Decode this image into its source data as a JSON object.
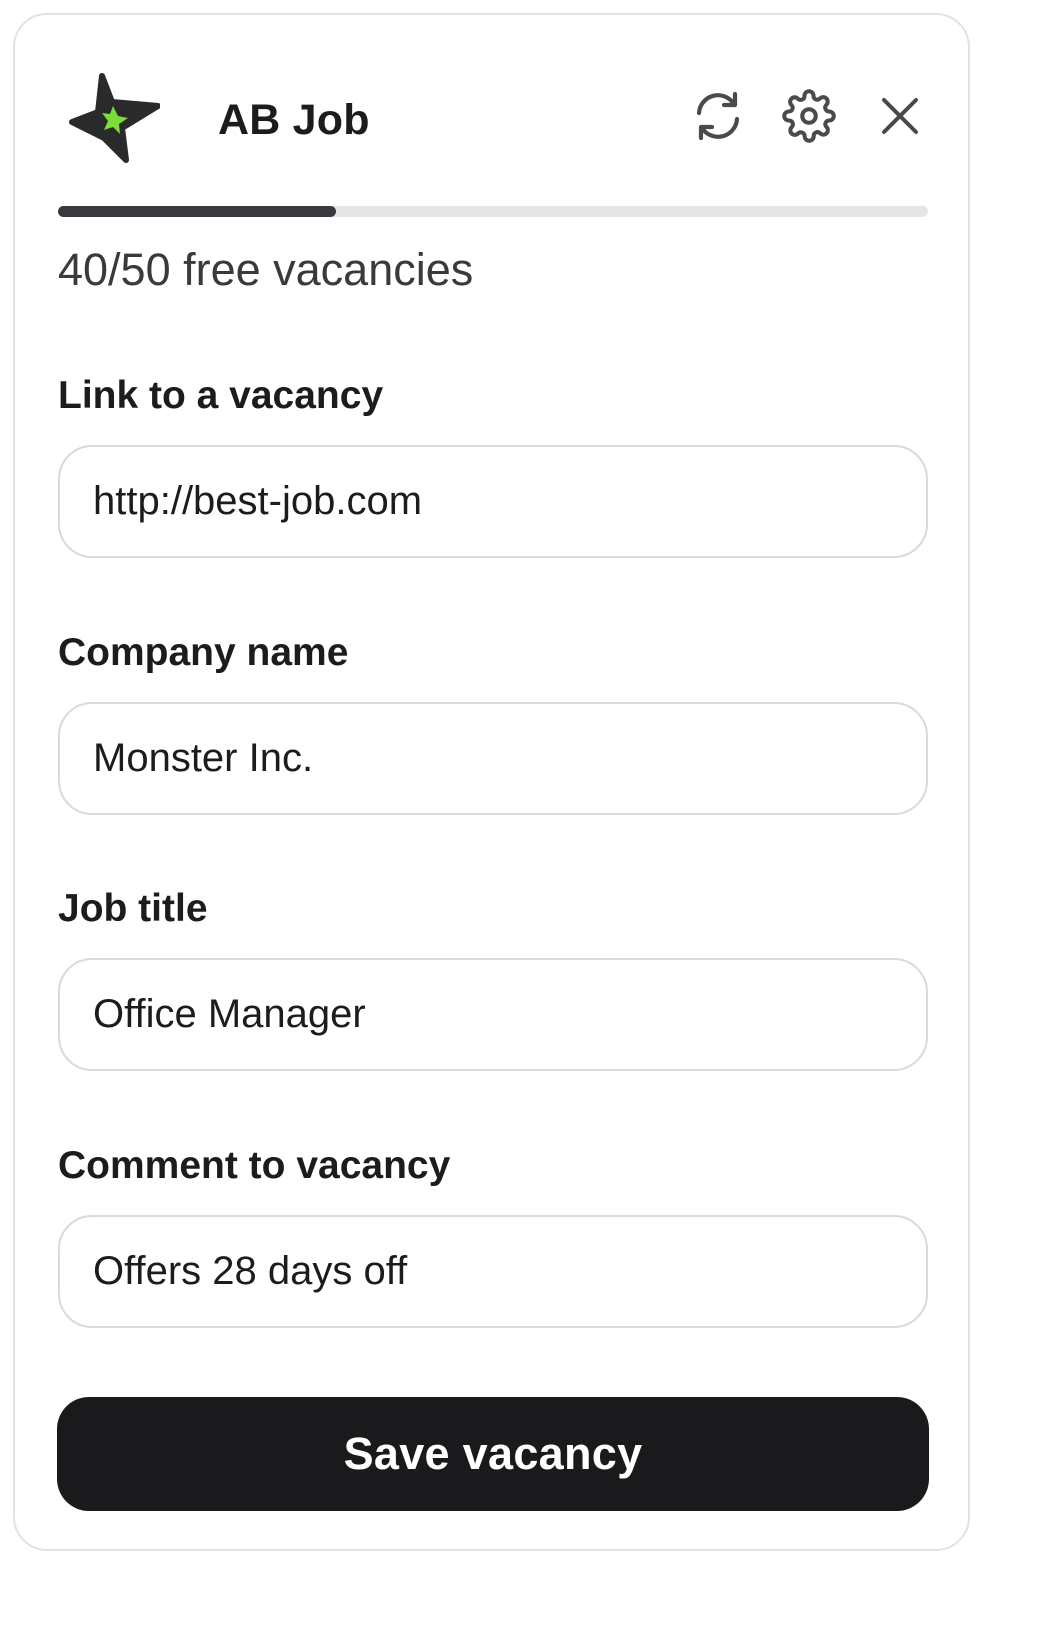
{
  "header": {
    "title": "AB Job",
    "icons": {
      "logo": "star-logo",
      "refresh": "refresh-icon",
      "settings": "gear-icon",
      "close": "close-icon"
    }
  },
  "quota": {
    "text": "40/50 free vacancies",
    "progress_fraction": 0.32
  },
  "form": {
    "link": {
      "label": "Link to a vacancy",
      "value": "http://best-job.com"
    },
    "company": {
      "label": "Company name",
      "value": "Monster Inc."
    },
    "job_title": {
      "label": "Job title",
      "value": "Office Manager"
    },
    "comment": {
      "label": "Comment to vacancy",
      "value": "Offers 28 days off"
    }
  },
  "actions": {
    "save_label": "Save vacancy"
  },
  "colors": {
    "accent_green": "#7bdc3a",
    "dark": "#1a1a1c",
    "icon_gray": "#4a4a4e",
    "progress_track": "#e6e6e8",
    "progress_fill": "#3a3a3e"
  }
}
